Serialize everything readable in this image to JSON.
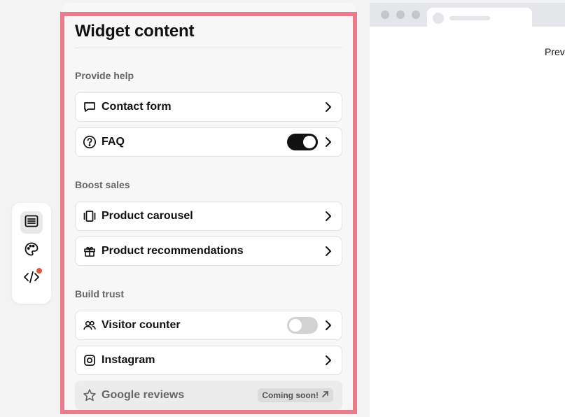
{
  "panel": {
    "title": "Widget content",
    "sections": [
      {
        "label": "Provide help",
        "items": [
          {
            "label": "Contact form",
            "icon": "message-square-icon"
          },
          {
            "label": "FAQ",
            "icon": "question-circle-icon",
            "toggle": "on"
          }
        ]
      },
      {
        "label": "Boost sales",
        "items": [
          {
            "label": "Product carousel",
            "icon": "gallery-icon"
          },
          {
            "label": "Product recommendations",
            "icon": "gift-icon"
          }
        ]
      },
      {
        "label": "Build trust",
        "items": [
          {
            "label": "Visitor counter",
            "icon": "users-icon",
            "toggle": "off"
          },
          {
            "label": "Instagram",
            "icon": "instagram-icon"
          },
          {
            "label": "Google reviews",
            "icon": "star-icon",
            "badge": "Coming soon!",
            "disabled": true
          }
        ]
      }
    ]
  },
  "toolbar": {
    "items": [
      {
        "icon": "list-icon",
        "active": true
      },
      {
        "icon": "palette-icon",
        "active": false
      },
      {
        "icon": "code-icon",
        "active": false,
        "notification": true
      }
    ]
  },
  "preview": {
    "label": "Previ"
  },
  "colors": {
    "highlight": "#e97b8c",
    "toggle_on": "#111111",
    "toggle_off": "#d2d2d2",
    "notification": "#e0553d"
  }
}
